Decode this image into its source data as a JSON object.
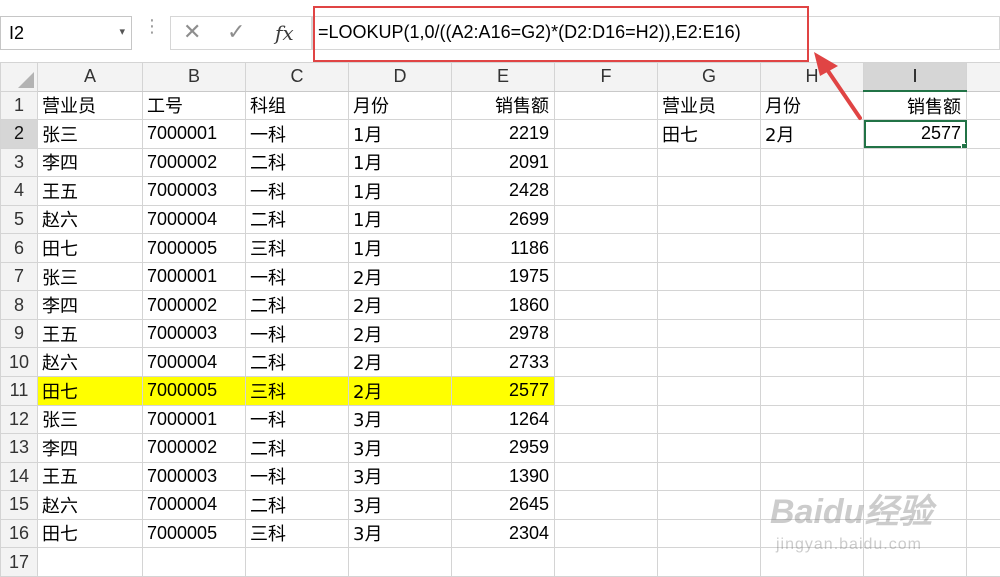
{
  "formula_bar": {
    "name_box": "I2",
    "name_box_dropdown": "▾",
    "dots": "⋮",
    "cancel_icon": "✕",
    "enter_icon": "✓",
    "fx_label": "fx",
    "formula": "=LOOKUP(1,0/((A2:A16=G2)*(D2:D16=H2)),E2:E16)"
  },
  "columns": [
    "A",
    "B",
    "C",
    "D",
    "E",
    "F",
    "G",
    "H",
    "I"
  ],
  "active_column": "I",
  "active_cell": "I2",
  "highlight_row": 11,
  "highlight_color": "#ffff00",
  "highlight_box_color": "#e04444",
  "selection_color": "#217346",
  "rows": [
    {
      "n": "1",
      "A": "营业员",
      "B": "工号",
      "C": "科组",
      "D": "月份",
      "E": "销售额",
      "F": "",
      "G": "营业员",
      "H": "月份",
      "I": "销售额"
    },
    {
      "n": "2",
      "A": "张三",
      "B": "7000001",
      "C": "一科",
      "D": "1月",
      "E": "2219",
      "F": "",
      "G": "田七",
      "H": "2月",
      "I": "2577"
    },
    {
      "n": "3",
      "A": "李四",
      "B": "7000002",
      "C": "二科",
      "D": "1月",
      "E": "2091",
      "F": "",
      "G": "",
      "H": "",
      "I": ""
    },
    {
      "n": "4",
      "A": "王五",
      "B": "7000003",
      "C": "一科",
      "D": "1月",
      "E": "2428",
      "F": "",
      "G": "",
      "H": "",
      "I": ""
    },
    {
      "n": "5",
      "A": "赵六",
      "B": "7000004",
      "C": "二科",
      "D": "1月",
      "E": "2699",
      "F": "",
      "G": "",
      "H": "",
      "I": ""
    },
    {
      "n": "6",
      "A": "田七",
      "B": "7000005",
      "C": "三科",
      "D": "1月",
      "E": "1186",
      "F": "",
      "G": "",
      "H": "",
      "I": ""
    },
    {
      "n": "7",
      "A": "张三",
      "B": "7000001",
      "C": "一科",
      "D": "2月",
      "E": "1975",
      "F": "",
      "G": "",
      "H": "",
      "I": ""
    },
    {
      "n": "8",
      "A": "李四",
      "B": "7000002",
      "C": "二科",
      "D": "2月",
      "E": "1860",
      "F": "",
      "G": "",
      "H": "",
      "I": ""
    },
    {
      "n": "9",
      "A": "王五",
      "B": "7000003",
      "C": "一科",
      "D": "2月",
      "E": "2978",
      "F": "",
      "G": "",
      "H": "",
      "I": ""
    },
    {
      "n": "10",
      "A": "赵六",
      "B": "7000004",
      "C": "二科",
      "D": "2月",
      "E": "2733",
      "F": "",
      "G": "",
      "H": "",
      "I": ""
    },
    {
      "n": "11",
      "A": "田七",
      "B": "7000005",
      "C": "三科",
      "D": "2月",
      "E": "2577",
      "F": "",
      "G": "",
      "H": "",
      "I": ""
    },
    {
      "n": "12",
      "A": "张三",
      "B": "7000001",
      "C": "一科",
      "D": "3月",
      "E": "1264",
      "F": "",
      "G": "",
      "H": "",
      "I": ""
    },
    {
      "n": "13",
      "A": "李四",
      "B": "7000002",
      "C": "二科",
      "D": "3月",
      "E": "2959",
      "F": "",
      "G": "",
      "H": "",
      "I": ""
    },
    {
      "n": "14",
      "A": "王五",
      "B": "7000003",
      "C": "一科",
      "D": "3月",
      "E": "1390",
      "F": "",
      "G": "",
      "H": "",
      "I": ""
    },
    {
      "n": "15",
      "A": "赵六",
      "B": "7000004",
      "C": "二科",
      "D": "3月",
      "E": "2645",
      "F": "",
      "G": "",
      "H": "",
      "I": ""
    },
    {
      "n": "16",
      "A": "田七",
      "B": "7000005",
      "C": "三科",
      "D": "3月",
      "E": "2304",
      "F": "",
      "G": "",
      "H": "",
      "I": ""
    },
    {
      "n": "17",
      "A": "",
      "B": "",
      "C": "",
      "D": "",
      "E": "",
      "F": "",
      "G": "",
      "H": "",
      "I": ""
    }
  ],
  "watermark": {
    "logo": "Baidu经验",
    "url": "jingyan.baidu.com"
  }
}
